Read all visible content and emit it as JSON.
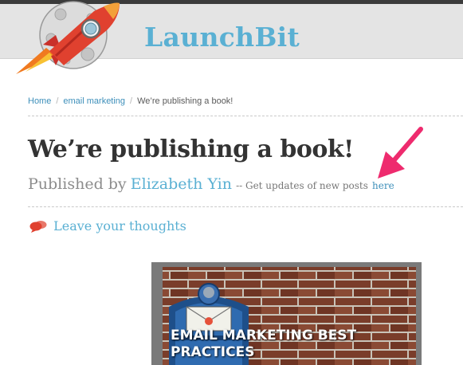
{
  "site": {
    "title": "LaunchBit"
  },
  "breadcrumb": [
    {
      "label": "Home",
      "link": true
    },
    {
      "label": "email marketing",
      "link": true
    },
    {
      "label": "We’re publishing a book!",
      "link": false
    }
  ],
  "breadcrumb_separator": "/",
  "post": {
    "title": "We’re publishing a book!",
    "published_by": "Published by",
    "author": "Elizabeth Yin",
    "updates_text": "-- Get updates of new posts",
    "updates_link": "here"
  },
  "comments": {
    "label": "Leave your thoughts",
    "icon": "speech-bubbles-icon"
  },
  "image": {
    "caption_line1": "EMAIL MARKETING BEST",
    "caption_line2": "PRACTICES"
  },
  "colors": {
    "accent": "#5ab0d3",
    "link": "#3d8fba",
    "arrow": "#ee2b6e",
    "header_bg": "#e4e4e4",
    "topbar": "#3b3b3b"
  }
}
